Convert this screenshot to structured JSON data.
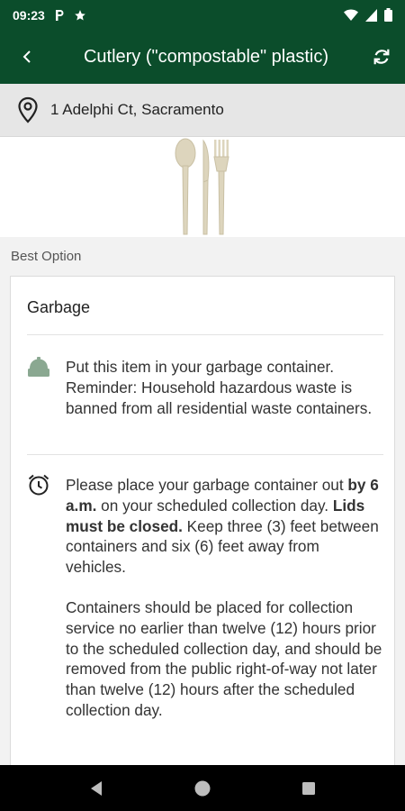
{
  "status": {
    "time": "09:23"
  },
  "appbar": {
    "title": "Cutlery (\"compostable\" plastic)"
  },
  "address": {
    "text": "1 Adelphi Ct, Sacramento"
  },
  "best_option": {
    "label": "Best Option",
    "category": "Garbage",
    "instruction": "Put this item in your garbage container. Reminder: Household hazardous waste is banned from all residential waste containers.",
    "schedule": {
      "p1_a": "Please place your garbage container out ",
      "p1_b": "by 6 a.m.",
      "p1_c": " on your scheduled collection day.  ",
      "p1_d": "Lids must be closed.",
      "p1_e": " Keep three (3) feet between containers and six (6) feet away from vehicles.",
      "p2": "Containers should be placed for collection service no earlier than twelve (12) hours prior to the scheduled collection day, and should be removed from the public right-of-way not later than twelve (12) hours after the scheduled collection day."
    }
  },
  "icons": {
    "status": [
      "parking-icon",
      "star-icon",
      "wifi-icon",
      "signal-icon",
      "battery-icon"
    ],
    "appbar": [
      "back-arrow-icon",
      "refresh-icon"
    ],
    "address": "location-pin-icon",
    "rows": [
      "garbage-bin-icon",
      "alarm-clock-icon"
    ],
    "nav": [
      "nav-back-icon",
      "nav-home-icon",
      "nav-recents-icon"
    ]
  },
  "colors": {
    "brand": "#0b4d2b",
    "address_bar": "#e6e6e6",
    "icon_green": "#8aa891"
  }
}
